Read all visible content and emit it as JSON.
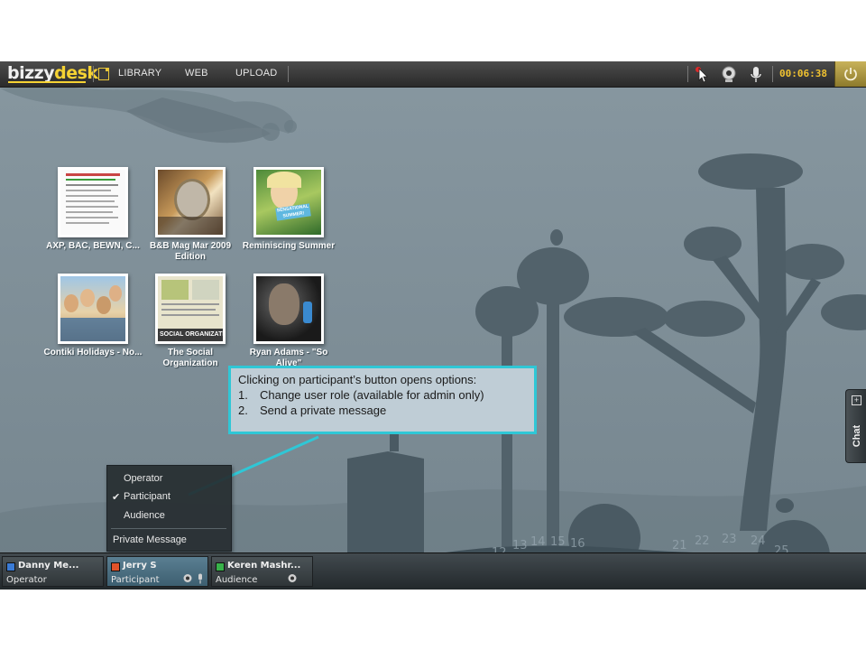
{
  "topbar": {
    "logo_part1": "bizzy",
    "logo_part2": "desk",
    "nav": [
      {
        "label": "LIBRARY",
        "icon": "document-icon"
      },
      {
        "label": "WEB"
      },
      {
        "label": "UPLOAD"
      }
    ],
    "tools": [
      "pointer-icon",
      "webcam-icon",
      "microphone-icon"
    ],
    "timer": "00:06:38",
    "power_icon": "power-icon"
  },
  "library": [
    {
      "label": "AXP, BAC, BEWN, C...",
      "thumb": "document-thumbnail"
    },
    {
      "label": "B&B Mag Mar 2009 Edition",
      "thumb": "magazine-thumbnail"
    },
    {
      "label": "Reminiscing Summer",
      "thumb": "photo-thumbnail",
      "caption": "SENSATIONAL SUMMER!"
    },
    {
      "label": "Contiki Holidays - No...",
      "thumb": "group-photo-thumbnail"
    },
    {
      "label": "The Social Organization",
      "thumb": "book-thumbnail",
      "caption": "SOCIAL ORGANIZATIO"
    },
    {
      "label": "Ryan Adams - \"So Alive\"",
      "thumb": "video-thumbnail"
    }
  ],
  "callout": {
    "title": "Clicking on participant’s button opens options:",
    "items": [
      {
        "num": "1.",
        "text": "Change user role (available for admin only)"
      },
      {
        "num": "2.",
        "text": "Send a private message"
      }
    ]
  },
  "context_menu": {
    "items": [
      {
        "label": "Operator",
        "checked": false
      },
      {
        "label": "Participant",
        "checked": true
      },
      {
        "label": "Audience",
        "checked": false
      }
    ],
    "check_glyph": "✔",
    "private_message": "Private Message"
  },
  "participants": [
    {
      "name": "Danny Me...",
      "role": "Operator",
      "status_color": "#3a7bd5",
      "selected": false,
      "icons": []
    },
    {
      "name": "Jerry S",
      "role": "Participant",
      "status_color": "#e0522a",
      "selected": true,
      "icons": [
        "webcam-icon",
        "microphone-icon"
      ]
    },
    {
      "name": "Keren Mashr...",
      "role": "Audience",
      "status_color": "#38b24a",
      "selected": false,
      "icons": [
        "webcam-icon"
      ]
    }
  ],
  "chat_tab": {
    "label": "Chat",
    "expand_glyph": "+"
  }
}
